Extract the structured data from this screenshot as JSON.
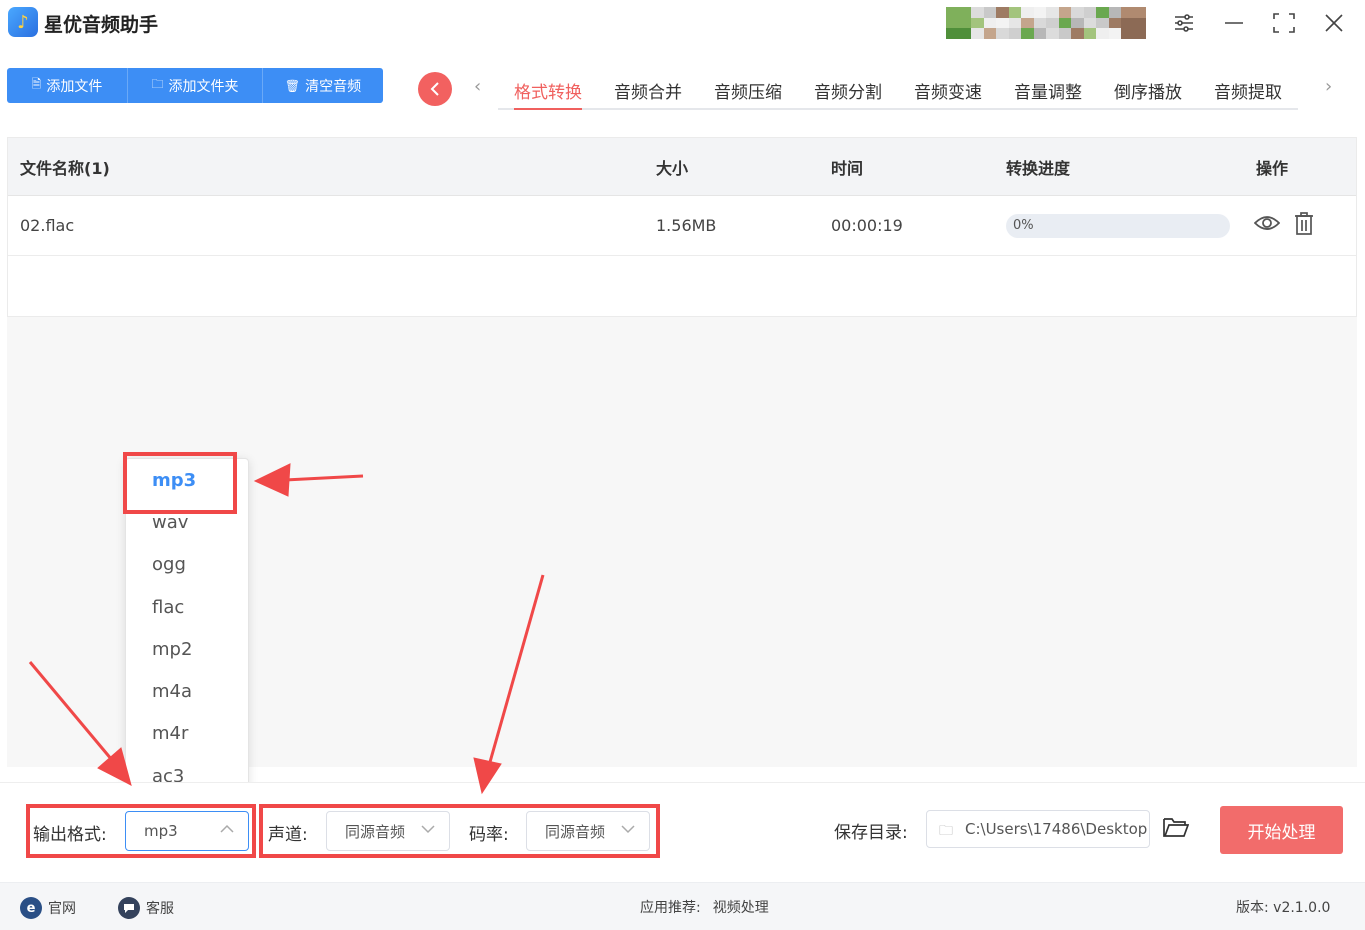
{
  "app": {
    "title": "星优音频助手",
    "logo_glyph": "♪"
  },
  "window_controls": {
    "settings": "≡",
    "minimize": "—",
    "maximize": "⛶",
    "close": "✕"
  },
  "toolbar": {
    "add_file": "添加文件",
    "add_folder": "添加文件夹",
    "clear_audio": "清空音频"
  },
  "tabs": {
    "items": [
      "格式转换",
      "音频合并",
      "音频压缩",
      "音频分割",
      "音频变速",
      "音量调整",
      "倒序播放",
      "音频提取"
    ],
    "active_index": 0
  },
  "table": {
    "headers": {
      "name": "文件名称(1)",
      "size": "大小",
      "time": "时间",
      "progress": "转换进度",
      "ops": "操作"
    },
    "rows": [
      {
        "name": "02.flac",
        "size": "1.56MB",
        "time": "00:00:19",
        "progress": 0.0,
        "progress_label": "0%"
      }
    ]
  },
  "format_dropdown": {
    "options": [
      "mp3",
      "wav",
      "ogg",
      "flac",
      "mp2",
      "m4a",
      "m4r",
      "ac3"
    ],
    "selected": "mp3"
  },
  "settings": {
    "output_format_label": "输出格式:",
    "output_format_value": "mp3",
    "channel_label": "声道:",
    "channel_value": "同源音频",
    "bitrate_label": "码率:",
    "bitrate_value": "同源音频",
    "save_dir_label": "保存目录:",
    "save_dir_value": "C:\\Users\\17486\\Desktop",
    "start_button": "开始处理"
  },
  "footer": {
    "website": "官网",
    "support": "客服",
    "recommend_label": "应用推荐:",
    "recommend_value": "视频处理",
    "version": "版本: v2.1.0.0"
  },
  "colors": {
    "primary": "#3d8ef5",
    "accent_red": "#f26160",
    "annotation_red": "#f04848"
  }
}
